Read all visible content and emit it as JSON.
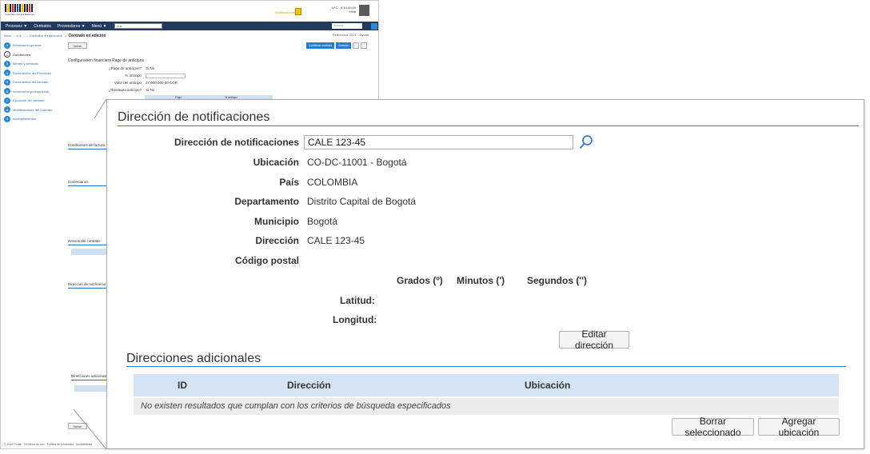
{
  "background": {
    "logo_caption": "Colombia Compra Eficiente",
    "notifications_link": "Notificaciones",
    "user_line1": "LFC - 8 10:00:00",
    "user_line2": "Hola",
    "nav": [
      "Procesos ▼",
      "Contratos",
      "Proveedores ▼",
      "Menú ▼"
    ],
    "nav_select": "Ir a",
    "search_placeholder": "Buscar",
    "breadcrumb_links": "Inicio → Ir a ... → Contratos en ejecución",
    "breadcrumb_current": "→ Contrato en edición",
    "help": "Referencia: CO1... Ayuda",
    "sidebar": [
      {
        "n": "1",
        "label": "Información general"
      },
      {
        "n": "2",
        "label": "Condiciones"
      },
      {
        "n": "3",
        "label": "Bienes y servicios"
      },
      {
        "n": "4",
        "label": "Documentos del Proveedor"
      },
      {
        "n": "5",
        "label": "Documentos del contrato"
      },
      {
        "n": "6",
        "label": "Información presupuestal"
      },
      {
        "n": "7",
        "label": "Ejecución del contrato"
      },
      {
        "n": "8",
        "label": "Modificaciones del Contrato"
      },
      {
        "n": "9",
        "label": "Incumplimientos"
      }
    ],
    "back_button": "Volver",
    "top_buttons": [
      "Confirmar contrato",
      "Guardar"
    ],
    "config_title": "Configuración financiera    Pago de anticipos",
    "field_labels": [
      "¿Pago de anticipos?",
      "% anticipo",
      "Valor del anticipo",
      "¿Reintegro anticipo?"
    ],
    "field_values": [
      "Sí  No",
      "",
      "27.000.000,00 COP",
      "Sí  No"
    ],
    "col_pago": "Pago",
    "col_porc": "% anticipo",
    "cond_label": "Condiciones de factura",
    "coment_label": "Comentarios",
    "anexos_label": "Anexos del contrato",
    "dir_label": "Dirección de notificaciones",
    "dir_adic_label": "Direcciones adicionales",
    "footer": "© 2016 Portal  ·  Términos de uso  ·  Política de privacidad  ·  Accesibilidad"
  },
  "panel": {
    "title": "Dirección de notificaciones",
    "fields": {
      "direccion_notif_label": "Dirección de notificaciones",
      "direccion_notif_value": "CALE 123-45",
      "ubicacion_label": "Ubicación",
      "ubicacion_value": "CO-DC-11001 - Bogotá",
      "pais_label": "País",
      "pais_value": "COLOMBIA",
      "departamento_label": "Departamento",
      "departamento_value": "Distrito Capital de Bogotá",
      "municipio_label": "Municipio",
      "municipio_value": "Bogotá",
      "direccion_label": "Dirección",
      "direccion_value": "CALE 123-45",
      "codigo_postal_label": "Código postal",
      "codigo_postal_value": ""
    },
    "coords": {
      "grados": "Grados (º)",
      "minutos": "Minutos (')",
      "segundos": "Segundos ('')",
      "latitud": "Latitud:",
      "longitud": "Longitud:"
    },
    "edit_button": "Editar dirección",
    "additional_title": "Direcciones adicionales",
    "table": {
      "columns": [
        "ID",
        "Dirección",
        "Ubicación"
      ],
      "empty_message": "No existen resultados que cumplan con los criterios de búsqueda especificados"
    },
    "delete_button": "Borrar seleccionado",
    "add_button": "Agregar ubicación"
  },
  "colors": {
    "accent_blue": "#2e7bc4",
    "table_header": "#d4e4f4",
    "nav_bar": "#233a5e"
  }
}
